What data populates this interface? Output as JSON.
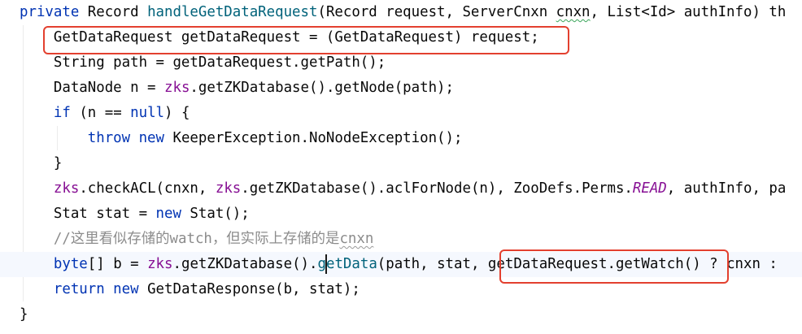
{
  "editor": {
    "lines": [
      {
        "tokens": [
          {
            "t": "private",
            "c": "kw"
          },
          {
            "t": " Record ",
            "c": "plain"
          },
          {
            "t": "handleGetDataRequest",
            "c": "fn"
          },
          {
            "t": "(Record request, ServerCnxn ",
            "c": "plain"
          },
          {
            "t": "cnxn",
            "c": "plain squig"
          },
          {
            "t": ", List<Id> authInfo) th",
            "c": "plain"
          }
        ]
      },
      {
        "tokens": [
          {
            "t": "    GetDataRequest getDataRequest = (GetDataRequest) request;",
            "c": "plain"
          }
        ]
      },
      {
        "tokens": [
          {
            "t": "    String path = getDataRequest.getPath();",
            "c": "plain"
          }
        ]
      },
      {
        "tokens": [
          {
            "t": "    DataNode n = ",
            "c": "plain"
          },
          {
            "t": "zks",
            "c": "field"
          },
          {
            "t": ".getZKDatabase().getNode(path);",
            "c": "plain"
          }
        ]
      },
      {
        "tokens": [
          {
            "t": "    ",
            "c": "plain"
          },
          {
            "t": "if",
            "c": "kw"
          },
          {
            "t": " (n == ",
            "c": "plain"
          },
          {
            "t": "null",
            "c": "kw"
          },
          {
            "t": ") {",
            "c": "plain"
          }
        ]
      },
      {
        "tokens": [
          {
            "t": "        ",
            "c": "plain"
          },
          {
            "t": "throw new",
            "c": "kw"
          },
          {
            "t": " KeeperException.NoNodeException();",
            "c": "plain"
          }
        ]
      },
      {
        "tokens": [
          {
            "t": "    }",
            "c": "plain"
          }
        ]
      },
      {
        "tokens": [
          {
            "t": "    ",
            "c": "plain"
          },
          {
            "t": "zks",
            "c": "field"
          },
          {
            "t": ".checkACL(cnxn, ",
            "c": "plain"
          },
          {
            "t": "zks",
            "c": "field"
          },
          {
            "t": ".getZKDatabase().aclForNode(n), ZooDefs.Perms.",
            "c": "plain"
          },
          {
            "t": "READ",
            "c": "const"
          },
          {
            "t": ", authInfo, pa",
            "c": "plain"
          }
        ]
      },
      {
        "tokens": [
          {
            "t": "    Stat stat = ",
            "c": "plain"
          },
          {
            "t": "new",
            "c": "kw"
          },
          {
            "t": " Stat();",
            "c": "plain"
          }
        ]
      },
      {
        "tokens": [
          {
            "t": "    //这里看似存储的watch，但实际上存储的是",
            "c": "comment"
          },
          {
            "t": "cnxn",
            "c": "comment squig-gray"
          }
        ]
      },
      {
        "tokens": [
          {
            "t": "    ",
            "c": "plain"
          },
          {
            "t": "byte",
            "c": "kw"
          },
          {
            "t": "[] b = ",
            "c": "plain"
          },
          {
            "t": "zks",
            "c": "field"
          },
          {
            "t": ".getZKDatabase().",
            "c": "plain"
          },
          {
            "t": "getData",
            "c": "fn"
          },
          {
            "t": "(path, stat, getDataRequest.getWatch() ? cnxn :",
            "c": "plain"
          }
        ],
        "highlight": true
      },
      {
        "tokens": [
          {
            "t": "    ",
            "c": "plain"
          },
          {
            "t": "return new",
            "c": "kw"
          },
          {
            "t": " GetDataResponse(b, stat);",
            "c": "plain"
          }
        ]
      },
      {
        "tokens": [
          {
            "t": "}",
            "c": "plain"
          }
        ]
      }
    ],
    "colors": {
      "background": "#ffffff",
      "keyword": "#0033b3",
      "method": "#00627a",
      "field": "#871094",
      "comment": "#8c8c8c",
      "annotation_box": "#e3402f",
      "current_line": "#f5f8fe"
    }
  }
}
